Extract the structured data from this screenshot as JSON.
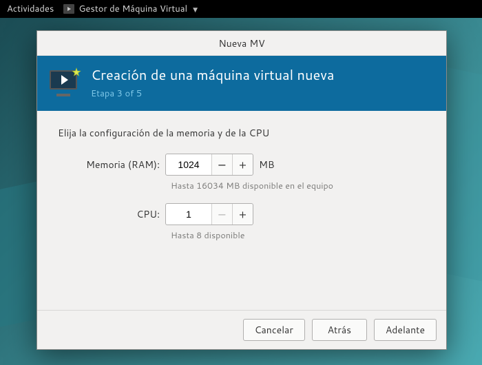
{
  "topbar": {
    "activities": "Actividades",
    "app_name": "Gestor de Máquina Virtual"
  },
  "dialog": {
    "title": "Nueva MV"
  },
  "banner": {
    "title": "Creación de una máquina virtual nueva",
    "subtitle": "Etapa 3 of 5"
  },
  "form": {
    "prompt": "Elija la configuración de la memoria y de la CPU",
    "memory": {
      "label": "Memoria (RAM):",
      "value": "1024",
      "unit": "MB",
      "hint": "Hasta 16034 MB disponible en el equipo"
    },
    "cpu": {
      "label": "CPU:",
      "value": "1",
      "hint": "Hasta 8 disponible"
    }
  },
  "buttons": {
    "cancel": "Cancelar",
    "back": "Atrás",
    "forward": "Adelante"
  }
}
